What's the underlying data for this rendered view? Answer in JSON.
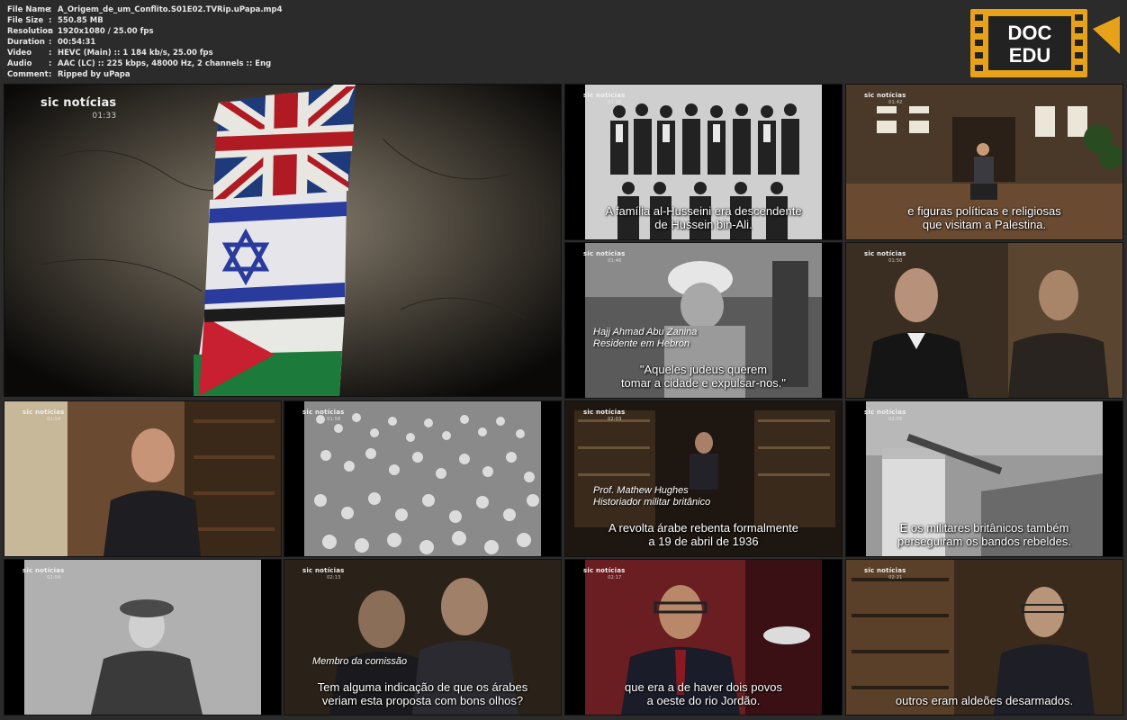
{
  "file_info": [
    {
      "key": "File Name",
      "value": "A_Origem_de_um_Conflito.S01E02.TVRip.uPapa.mp4"
    },
    {
      "key": "File Size",
      "value": "550.85 MB"
    },
    {
      "key": "Resolution",
      "value": "1920x1080 / 25.00 fps"
    },
    {
      "key": "Duration",
      "value": "00:54:31"
    },
    {
      "key": "Video",
      "value": "HEVC (Main) :: 1 184 kb/s, 25.00 fps"
    },
    {
      "key": "Audio",
      "value": "AAC (LC) :: 225 kbps, 48000 Hz, 2 channels :: Eng"
    },
    {
      "key": "Comment",
      "value": "Ripped by uPapa"
    }
  ],
  "separator": ":",
  "logo": {
    "line1": "DOC",
    "line2": "EDU",
    "color": "#f0a500"
  },
  "channel": "sic notícias",
  "thumbnails": [
    {
      "timecode": "01:33",
      "subtitle": [],
      "caption": []
    },
    {
      "timecode": "01:38",
      "subtitle": [
        "A família al-Husseini era descendente",
        "de Hussein bin-Ali."
      ],
      "caption": []
    },
    {
      "timecode": "01:42",
      "subtitle": [
        "e figuras políticas e religiosas",
        "que visitam a Palestina."
      ],
      "caption": []
    },
    {
      "timecode": "01:46",
      "subtitle": [
        "\"Aqueles judeus querem",
        "tomar a cidade e expulsar-nos.\""
      ],
      "caption": [
        "Hajj Ahmad Abu Zanina",
        "Residente em Hebron"
      ]
    },
    {
      "timecode": "01:50",
      "subtitle": [],
      "caption": []
    },
    {
      "timecode": "01:54",
      "subtitle": [],
      "caption": []
    },
    {
      "timecode": "01:58",
      "subtitle": [],
      "caption": []
    },
    {
      "timecode": "02:03",
      "subtitle": [
        "A revolta árabe rebenta formalmente",
        "a 19 de abril de 1936"
      ],
      "caption": [
        "Prof. Mathew Hughes",
        "Historiador militar britânico"
      ]
    },
    {
      "timecode": "02:05",
      "subtitle": [
        "E os militares britânicos também",
        "perseguiram os bandos rebeldes."
      ],
      "caption": []
    },
    {
      "timecode": "02:09",
      "subtitle": [],
      "caption": []
    },
    {
      "timecode": "02:13",
      "subtitle": [
        "Tem alguma indicação de que os árabes",
        "veriam esta proposta com bons olhos?"
      ],
      "caption": [
        "Membro da comissão"
      ]
    },
    {
      "timecode": "02:17",
      "subtitle": [
        "que era a de haver dois povos",
        "a oeste do rio Jordão."
      ],
      "caption": []
    },
    {
      "timecode": "02:21",
      "subtitle": [
        "outros eram aldeões desarmados."
      ],
      "caption": []
    }
  ]
}
